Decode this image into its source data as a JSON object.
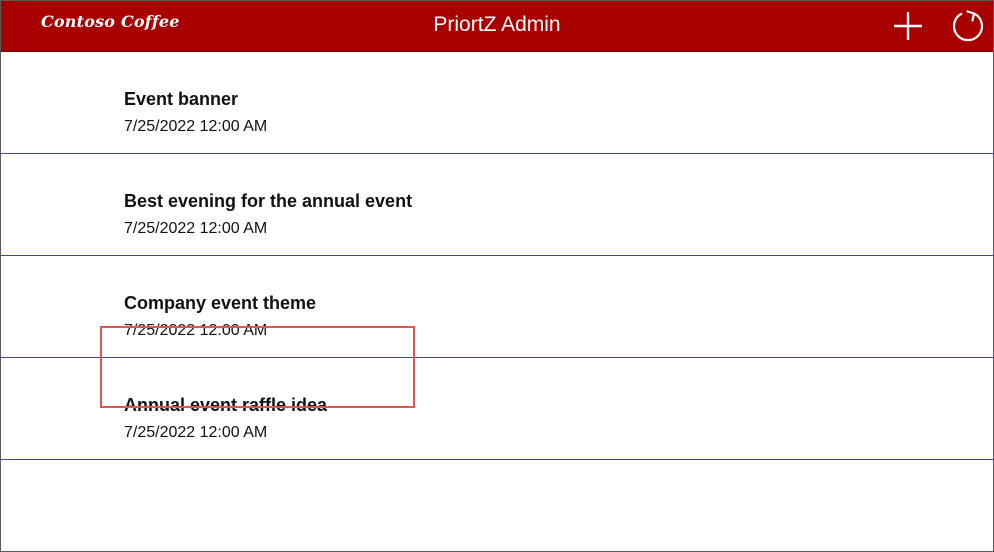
{
  "header": {
    "logo_text": "Contoso Coffee",
    "title": "PriortZ Admin",
    "add_icon": "plus-icon",
    "refresh_icon": "refresh-icon"
  },
  "gallery": {
    "items": [
      {
        "title": "Event banner",
        "date": "7/25/2022 12:00 AM"
      },
      {
        "title": "Best evening for the annual event",
        "date": "7/25/2022 12:00 AM"
      },
      {
        "title": "Company event theme",
        "date": "7/25/2022 12:00 AM"
      },
      {
        "title": "Annual event raffle idea",
        "date": "7/25/2022 12:00 AM"
      }
    ],
    "highlighted_item": "Annual event raffle idea"
  },
  "colors": {
    "header_bg": "#a80000",
    "separator": "#3d4aa0",
    "highlight": "#e05555"
  }
}
